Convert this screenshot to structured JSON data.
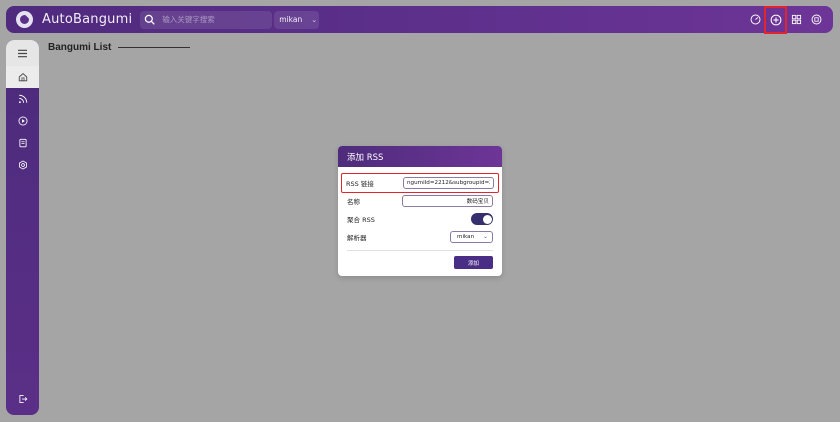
{
  "app": {
    "title": "AutoBangumi"
  },
  "search": {
    "placeholder": "输入关键字搜索"
  },
  "source": {
    "selected": "mikan"
  },
  "top_actions": [
    {
      "icon": "dashboard-icon"
    },
    {
      "icon": "add-circle-icon"
    },
    {
      "icon": "grid-icon"
    },
    {
      "icon": "power-icon"
    }
  ],
  "sidebar": {
    "items": [
      {
        "icon": "menu-icon"
      },
      {
        "icon": "home-icon"
      },
      {
        "icon": "rss-icon"
      },
      {
        "icon": "play-icon"
      },
      {
        "icon": "log-icon"
      },
      {
        "icon": "settings-icon"
      }
    ],
    "logout_icon": "logout-icon"
  },
  "page": {
    "title": "Bangumi List"
  },
  "modal": {
    "title": "添加 RSS",
    "rss_link_label": "RSS 链接",
    "rss_link_value": "ngumiId=2212&subgroupid=202",
    "name_label": "名称",
    "name_value": "数码宝贝",
    "aggregate_label": "聚合 RSS",
    "aggregate_on": true,
    "parser_label": "解析器",
    "parser_value": "mikan",
    "add_button": "添加"
  },
  "colors": {
    "primary": "#4e2c7b",
    "highlight": "#e0262c",
    "toggle": "#352f6e"
  }
}
